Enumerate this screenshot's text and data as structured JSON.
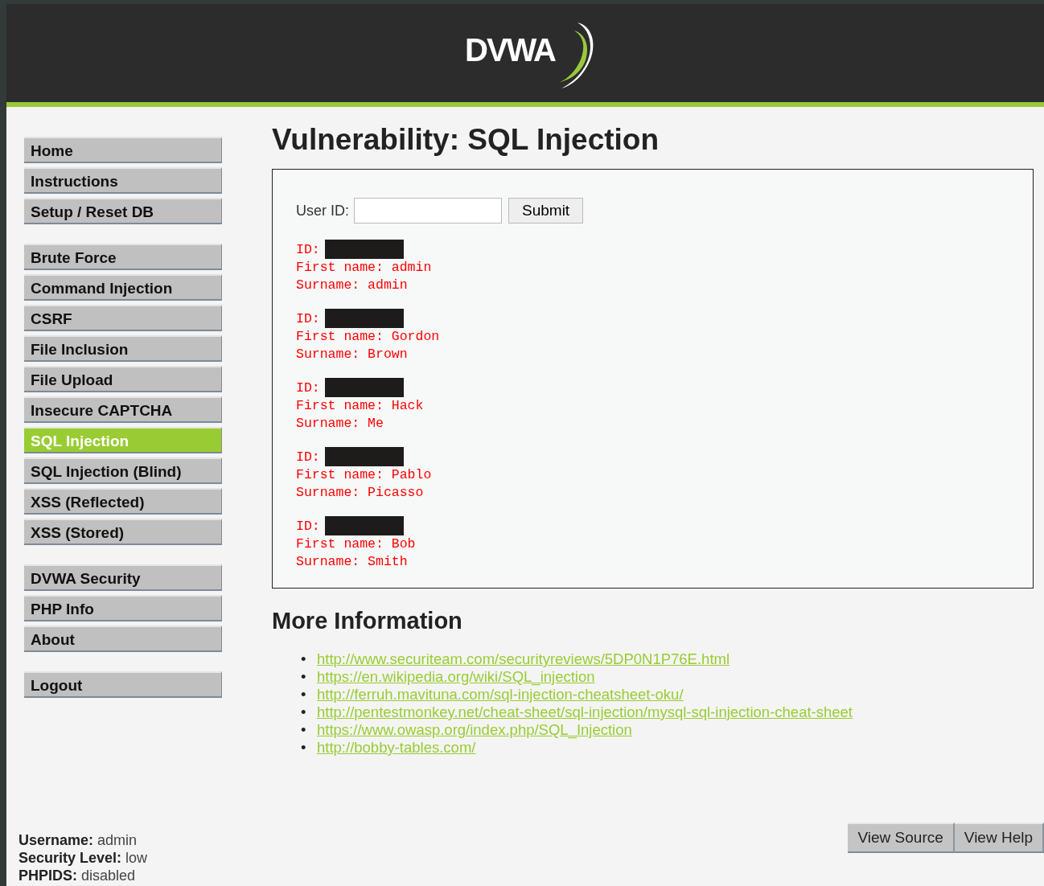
{
  "header": {
    "logo": "DVWA"
  },
  "sidebar": {
    "groups": [
      [
        {
          "label": "Home",
          "selected": false
        },
        {
          "label": "Instructions",
          "selected": false
        },
        {
          "label": "Setup / Reset DB",
          "selected": false
        }
      ],
      [
        {
          "label": "Brute Force",
          "selected": false
        },
        {
          "label": "Command Injection",
          "selected": false
        },
        {
          "label": "CSRF",
          "selected": false
        },
        {
          "label": "File Inclusion",
          "selected": false
        },
        {
          "label": "File Upload",
          "selected": false
        },
        {
          "label": "Insecure CAPTCHA",
          "selected": false
        },
        {
          "label": "SQL Injection",
          "selected": true
        },
        {
          "label": "SQL Injection (Blind)",
          "selected": false
        },
        {
          "label": "XSS (Reflected)",
          "selected": false
        },
        {
          "label": "XSS (Stored)",
          "selected": false
        }
      ],
      [
        {
          "label": "DVWA Security",
          "selected": false
        },
        {
          "label": "PHP Info",
          "selected": false
        },
        {
          "label": "About",
          "selected": false
        }
      ],
      [
        {
          "label": "Logout",
          "selected": false
        }
      ]
    ]
  },
  "main": {
    "title": "Vulnerability: SQL Injection",
    "form": {
      "label": "User ID:",
      "button": "Submit"
    },
    "results": [
      {
        "id_label": "ID:",
        "first_name": "First name: admin",
        "surname": "Surname: admin"
      },
      {
        "id_label": "ID:",
        "first_name": "First name: Gordon",
        "surname": "Surname: Brown"
      },
      {
        "id_label": "ID:",
        "first_name": "First name: Hack",
        "surname": "Surname: Me"
      },
      {
        "id_label": "ID:",
        "first_name": "First name: Pablo",
        "surname": "Surname: Picasso"
      },
      {
        "id_label": "ID:",
        "first_name": "First name: Bob",
        "surname": "Surname: Smith"
      }
    ],
    "more_info": {
      "heading": "More Information",
      "links": [
        {
          "bullet": "•",
          "url": "http://www.securiteam.com/securityreviews/5DP0N1P76E.html"
        },
        {
          "bullet": "•",
          "url": "https://en.wikipedia.org/wiki/SQL_injection"
        },
        {
          "bullet": "•",
          "url": "http://ferruh.mavituna.com/sql-injection-cheatsheet-oku/"
        },
        {
          "bullet": "•",
          "url": "http://pentestmonkey.net/cheat-sheet/sql-injection/mysql-sql-injection-cheat-sheet"
        },
        {
          "bullet": "•",
          "url": "https://www.owasp.org/index.php/SQL_Injection"
        },
        {
          "bullet": "•",
          "url": "http://bobby-tables.com/"
        }
      ]
    }
  },
  "footer": {
    "info": [
      {
        "label": "Username:",
        "value": "admin"
      },
      {
        "label": "Security Level:",
        "value": "low"
      },
      {
        "label": "PHPIDS:",
        "value": "disabled"
      }
    ],
    "buttons": [
      "View Source",
      "View Help"
    ]
  }
}
